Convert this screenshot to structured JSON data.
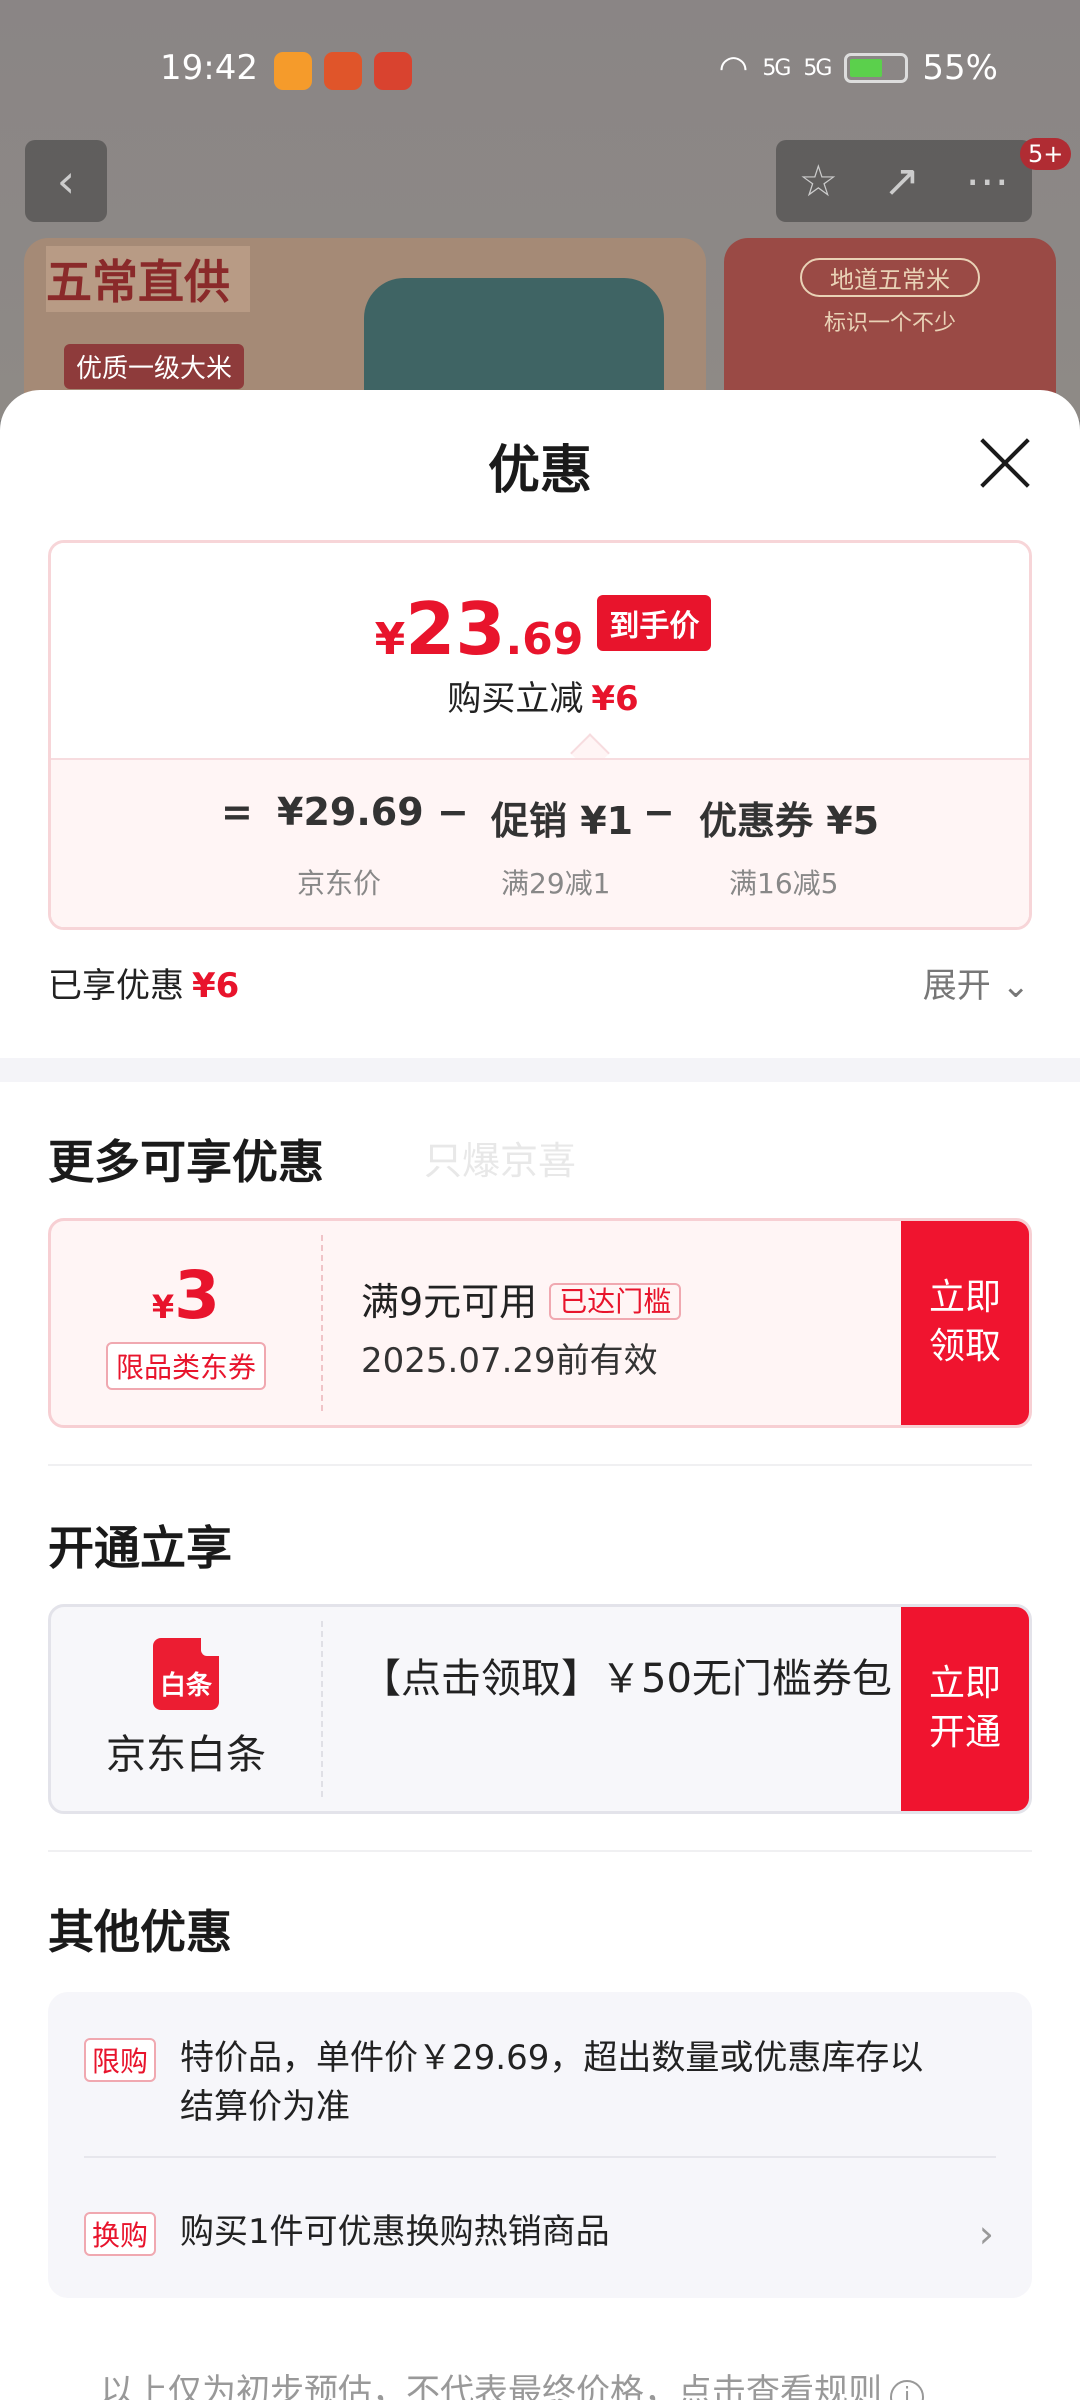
{
  "status_bar": {
    "time": "19:42",
    "network1": "5G",
    "network2": "5G",
    "battery": "55%",
    "battery_fill": 0.55
  },
  "product_page": {
    "banner_left_title": "五常直供",
    "banner_left_tag": "优质一级大米",
    "banner_right_title": "地道五常米",
    "banner_right_sub": "标识一个不少",
    "badge": "5+"
  },
  "sheet": {
    "title": "优惠",
    "price": {
      "currency": "¥",
      "int": "23",
      "dec": ".69",
      "tag": "到手价",
      "reduce_label": "购买立减",
      "reduce_value": "¥6"
    },
    "formula": {
      "eq": "=",
      "base_value": "¥29.69",
      "base_label": "京东价",
      "minus1": "−",
      "promo_value": "促销 ¥1",
      "promo_label": "满29减1",
      "minus2": "−",
      "coupon_value": "优惠券 ¥5",
      "coupon_label": "满16减5"
    },
    "enjoyed_label": "已享优惠",
    "enjoyed_value": "¥6",
    "expand_label": "展开 ⌄"
  },
  "more": {
    "title": "更多可享优惠",
    "watermark": "只爆京喜",
    "coupon": {
      "currency": "¥",
      "amount": "3",
      "tag": "限品类东券",
      "condition": "满9元可用",
      "met": "已达门槛",
      "expiry": "2025.07.29前有效",
      "button": "立即\n领取"
    }
  },
  "open": {
    "title": "开通立享",
    "card": {
      "icon_text": "白条",
      "label": "京东白条",
      "text": "【点击领取】￥50无门槛券包",
      "button": "立即\n开通"
    }
  },
  "other": {
    "title": "其他优惠",
    "items": [
      {
        "tag": "限购",
        "text": "特价品，单件价￥29.69，超出数量或优惠库存以结算价为准"
      },
      {
        "tag": "换购",
        "text": "购买1件可优惠换购热销商品"
      }
    ]
  },
  "footer": {
    "text": "以上仅为初步预估，不代表最终价格，点击查看规则",
    "icon": "i"
  }
}
